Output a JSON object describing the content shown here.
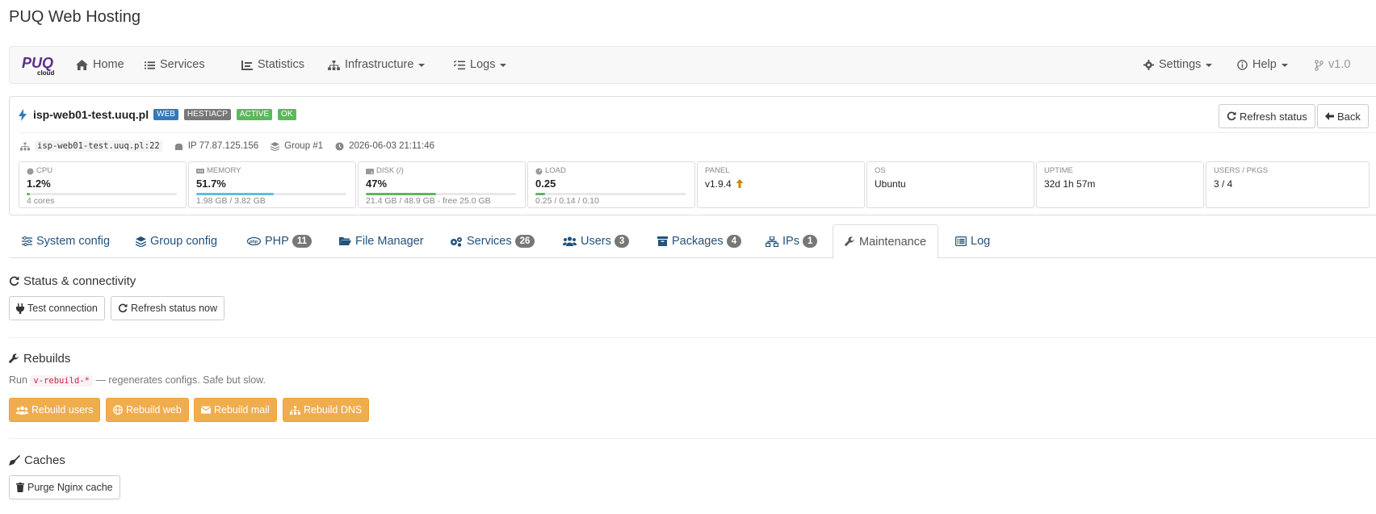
{
  "app": {
    "title": "PUQ Web Hosting"
  },
  "navbar": {
    "brand": {
      "top": "PUQ",
      "bottom": "cloud"
    },
    "items": [
      {
        "label": "Home",
        "icon": "home-icon"
      },
      {
        "label": "Services",
        "icon": "list-icon"
      },
      {
        "label": "Statistics",
        "icon": "chart-icon"
      },
      {
        "label": "Infrastructure",
        "icon": "sitemap-icon",
        "dropdown": true
      },
      {
        "label": "Logs",
        "icon": "tasks-icon",
        "dropdown": true
      }
    ],
    "right": [
      {
        "label": "Settings",
        "icon": "gear-icon",
        "dropdown": true
      },
      {
        "label": "Help",
        "icon": "info-icon",
        "dropdown": true
      },
      {
        "label": "v1.0",
        "icon": "git-branch-icon"
      }
    ]
  },
  "server": {
    "name": "isp-web01-test.uuq.pl",
    "badges": [
      "WEB",
      "HESTIACP",
      "ACTIVE",
      "OK"
    ],
    "refresh_label": "Refresh status",
    "back_label": "Back",
    "host": "isp-web01-test.uuq.pl:22",
    "ip": "IP 77.87.125.156",
    "group": "Group #1",
    "timestamp": "2026-06-03 21:11:46"
  },
  "stats": [
    {
      "label": "CPU",
      "value": "1.2%",
      "sub": "4 cores",
      "bar": 0.012,
      "color": "#5cb85c"
    },
    {
      "label": "MEMORY",
      "value": "51.7%",
      "sub": "1.98 GB / 3.82 GB",
      "bar": 0.517,
      "color": "#5bc0de"
    },
    {
      "label": "DISK (/)",
      "value": "47%",
      "sub": "21.4 GB / 48.9 GB · free 25.0 GB",
      "bar": 0.47,
      "color": "#5cb85c"
    },
    {
      "label": "LOAD",
      "value": "0.25",
      "sub": "0.25 / 0.14 / 0.10",
      "bar": 0.0625,
      "color": "#5cb85c"
    },
    {
      "label": "PANEL",
      "value": "v1.9.4"
    },
    {
      "label": "OS",
      "value": "Ubuntu"
    },
    {
      "label": "UPTIME",
      "value": "32d 1h 57m"
    },
    {
      "label": "USERS / PKGS",
      "value": "3 / 4"
    }
  ],
  "tabs": [
    {
      "label": "System config"
    },
    {
      "label": "Group config"
    },
    {
      "label": "PHP",
      "count": "11"
    },
    {
      "label": "File Manager"
    },
    {
      "label": "Services",
      "count": "26"
    },
    {
      "label": "Users",
      "count": "3"
    },
    {
      "label": "Packages",
      "count": "4"
    },
    {
      "label": "IPs",
      "count": "1"
    },
    {
      "label": "Maintenance",
      "active": true
    },
    {
      "label": "Log"
    }
  ],
  "maintenance": {
    "status": {
      "title": "Status & connectivity",
      "test_label": "Test connection",
      "refresh_label": "Refresh status now"
    },
    "rebuilds": {
      "title": "Rebuilds",
      "desc_prefix": "Run",
      "desc_code": "v-rebuild-*",
      "desc_suffix": "— regenerates configs. Safe but slow.",
      "buttons": [
        "Rebuild users",
        "Rebuild web",
        "Rebuild mail",
        "Rebuild DNS"
      ]
    },
    "caches": {
      "title": "Caches",
      "purge_label": "Purge Nginx cache"
    }
  }
}
